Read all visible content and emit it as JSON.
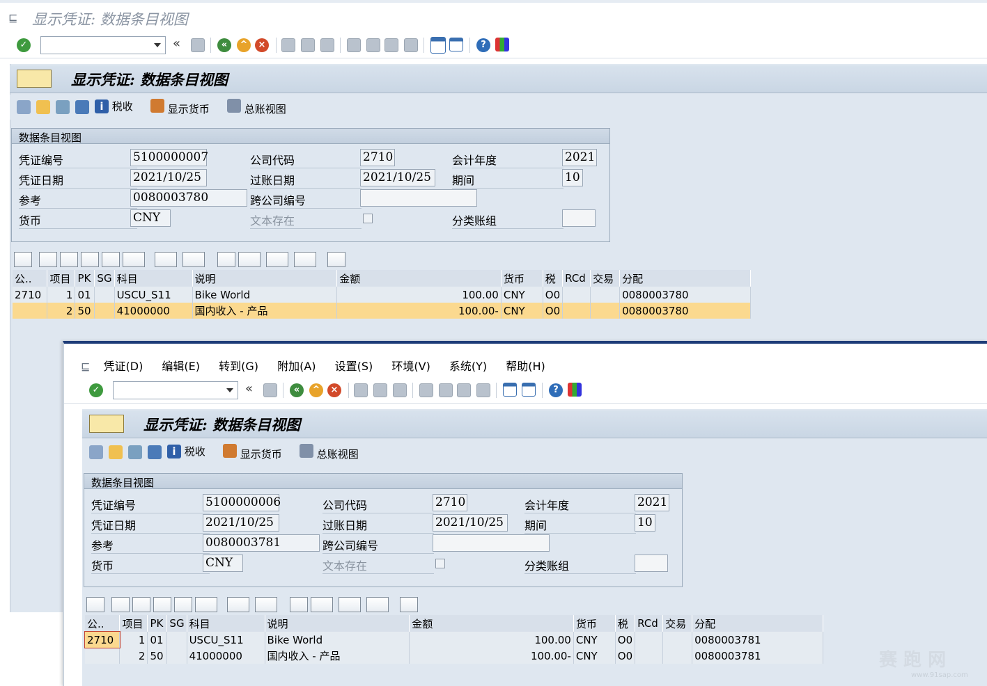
{
  "top": {
    "window_title": "显示凭证: 数据条目视图",
    "page_title": "显示凭证: 数据条目视图",
    "toolbar": {
      "collapse": "«"
    },
    "app_toolbar": {
      "tax": "税收",
      "display_currency": "显示货币",
      "gl_view": "总账视图"
    },
    "group_title": "数据条目视图",
    "fields": {
      "doc_no_label": "凭证编号",
      "doc_no": "5100000007",
      "company_label": "公司代码",
      "company": "2710",
      "fiscal_year_label": "会计年度",
      "fiscal_year": "2021",
      "doc_date_label": "凭证日期",
      "doc_date": "2021/10/25",
      "posting_date_label": "过账日期",
      "posting_date": "2021/10/25",
      "period_label": "期间",
      "period": "10",
      "reference_label": "参考",
      "reference": "0080003780",
      "cross_company_label": "跨公司编号",
      "cross_company": "",
      "currency_label": "货币",
      "currency": "CNY",
      "text_exists_label": "文本存在",
      "ledger_group_label": "分类账组",
      "ledger_group": ""
    },
    "grid": {
      "headers": [
        "公..",
        "项目",
        "PK",
        "SG",
        "科目",
        "说明",
        "金额",
        "货币",
        "税",
        "RCd",
        "交易",
        "分配"
      ],
      "rows": [
        {
          "co": "2710",
          "item": "1",
          "pk": "01",
          "sg": "",
          "account": "USCU_S11",
          "desc": "Bike World",
          "amount": "100.00",
          "cur": "CNY",
          "tax": "O0",
          "rcd": "",
          "trade": "",
          "assign": "0080003780"
        },
        {
          "co": "",
          "item": "2",
          "pk": "50",
          "sg": "",
          "account": "41000000",
          "desc": "国内收入 - 产品",
          "amount": "100.00-",
          "cur": "CNY",
          "tax": "O0",
          "rcd": "",
          "trade": "",
          "assign": "0080003780"
        }
      ]
    }
  },
  "bottom": {
    "menu": [
      "凭证(D)",
      "编辑(E)",
      "转到(G)",
      "附加(A)",
      "设置(S)",
      "环境(V)",
      "系统(Y)",
      "帮助(H)"
    ],
    "toolbar": {
      "collapse": "«"
    },
    "page_title": "显示凭证: 数据条目视图",
    "app_toolbar": {
      "tax": "税收",
      "display_currency": "显示货币",
      "gl_view": "总账视图"
    },
    "group_title": "数据条目视图",
    "fields": {
      "doc_no_label": "凭证编号",
      "doc_no": "5100000006",
      "company_label": "公司代码",
      "company": "2710",
      "fiscal_year_label": "会计年度",
      "fiscal_year": "2021",
      "doc_date_label": "凭证日期",
      "doc_date": "2021/10/25",
      "posting_date_label": "过账日期",
      "posting_date": "2021/10/25",
      "period_label": "期间",
      "period": "10",
      "reference_label": "参考",
      "reference": "0080003781",
      "cross_company_label": "跨公司编号",
      "cross_company": "",
      "currency_label": "货币",
      "currency": "CNY",
      "text_exists_label": "文本存在",
      "ledger_group_label": "分类账组",
      "ledger_group": ""
    },
    "grid": {
      "headers": [
        "公..",
        "项目",
        "PK",
        "SG",
        "科目",
        "说明",
        "金额",
        "货币",
        "税",
        "RCd",
        "交易",
        "分配"
      ],
      "rows": [
        {
          "co": "2710",
          "item": "1",
          "pk": "01",
          "sg": "",
          "account": "USCU_S11",
          "desc": "Bike World",
          "amount": "100.00",
          "cur": "CNY",
          "tax": "O0",
          "rcd": "",
          "trade": "",
          "assign": "0080003781"
        },
        {
          "co": "",
          "item": "2",
          "pk": "50",
          "sg": "",
          "account": "41000000",
          "desc": "国内收入 - 产品",
          "amount": "100.00-",
          "cur": "CNY",
          "tax": "O0",
          "rcd": "",
          "trade": "",
          "assign": "0080003781"
        }
      ]
    }
  },
  "watermark": {
    "text": "赛 跑 网",
    "url": "www.91sap.com"
  },
  "colors": {
    "selected_row": "#fbd98f",
    "panel": "#dfe7f0",
    "title_band": "#c9d6e4"
  }
}
